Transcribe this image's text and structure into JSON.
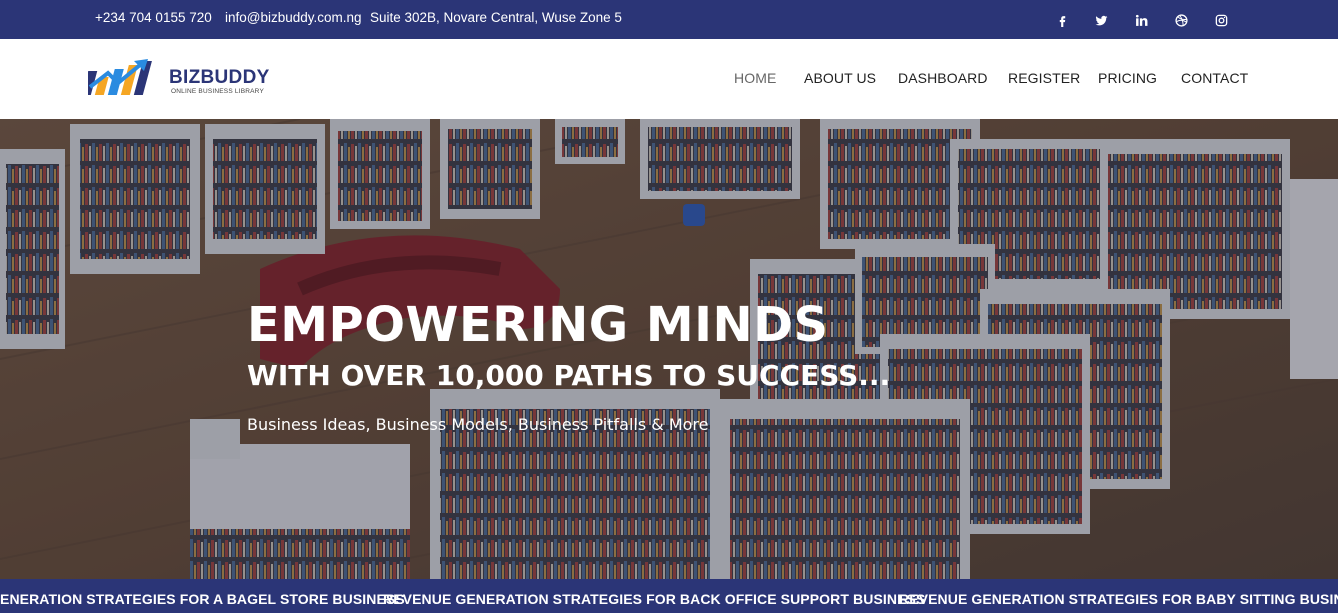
{
  "topbar": {
    "phone": "+234 704 0155 720",
    "email": "info@bizbuddy.com.ng",
    "address": "Suite 302B, Novare Central, Wuse Zone 5",
    "social_icons": [
      "facebook-icon",
      "twitter-icon",
      "linkedin-icon",
      "dribbble-icon",
      "instagram-icon"
    ]
  },
  "logo": {
    "name": "BIZBUDDY",
    "tagline": "ONLINE BUSINESS LIBRARY"
  },
  "nav": {
    "items": [
      {
        "label": "HOME",
        "active": true
      },
      {
        "label": "ABOUT US"
      },
      {
        "label": "DASHBOARD"
      },
      {
        "label": "REGISTER"
      },
      {
        "label": "PRICING"
      },
      {
        "label": "CONTACT"
      }
    ]
  },
  "hero": {
    "title": "EMPOWERING MINDS",
    "subtitle": "WITH OVER 10,000 PATHS TO SUCCESS...",
    "tagline": "Business Ideas, Business Models, Business Pitfalls & More"
  },
  "ticker": {
    "items": [
      "ENERATION STRATEGIES FOR A BAGEL STORE BUSINESS",
      "REVENUE GENERATION STRATEGIES FOR BACK OFFICE SUPPORT BUSINESS",
      "REVENUE GENERATION STRATEGIES FOR BABY SITTING BUSINESS"
    ]
  },
  "colors": {
    "brand_navy": "#2b3577",
    "accent_orange": "#f5a623",
    "accent_blue": "#2a8be0"
  }
}
